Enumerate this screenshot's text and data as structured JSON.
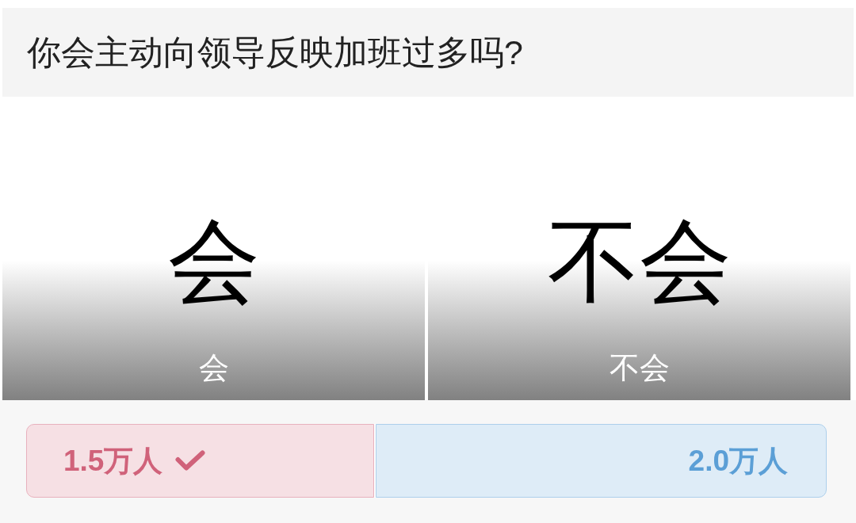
{
  "question": {
    "title": "你会主动向领导反映加班过多吗?"
  },
  "options": [
    {
      "image_text": "会",
      "label": "会"
    },
    {
      "image_text": "不会",
      "label": "不会"
    }
  ],
  "results": [
    {
      "count": "1.5万人",
      "selected": true,
      "level": 0.43,
      "color": "#d0627a"
    },
    {
      "count": "2.0万人",
      "selected": false,
      "level": 0.57,
      "color": "#5b9fd6"
    }
  ]
}
